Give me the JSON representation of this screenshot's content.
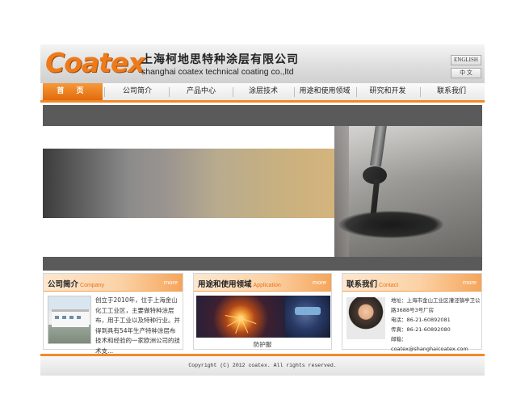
{
  "header": {
    "logo": "Coatex",
    "company_cn": "上海柯地思特种涂层有限公司",
    "company_en": "shanghai coatex technical coating co.,ltd",
    "lang_en": "ENGLISH",
    "lang_cn": "中 文"
  },
  "nav": {
    "items": [
      {
        "label": "首 页",
        "active": true
      },
      {
        "label": "公司简介"
      },
      {
        "label": "产品中心"
      },
      {
        "label": "涂层技术"
      },
      {
        "label": "用途和使用领域"
      },
      {
        "label": "研究和开发"
      },
      {
        "label": "联系我们"
      }
    ]
  },
  "panels": {
    "about": {
      "title": "公司简介",
      "sub": "Company",
      "more": "more",
      "text": "创立于2010年，位于上海金山化工工业区，主要做特种涂层布，用于工业以及特种行业。并得到具有54年生产特种涂层布技术和经验的一家欧洲公司的技术支..."
    },
    "application": {
      "title": "用途和使用领域",
      "sub": "Application",
      "more": "more",
      "caption": "防护服"
    },
    "contact": {
      "title": "联系我们",
      "sub": "Contact",
      "more": "more",
      "address": "地址：上海市金山工业区漕泾镇亭卫公路3688号3号厂房",
      "phone": "电话：86-21-60892081",
      "fax": "传真：86-21-60892080",
      "email": "邮箱：coatex@shanghaicoatex.com"
    }
  },
  "footer": {
    "copyright": "Copyright (C) 2012 coatex. All rights reserved."
  }
}
